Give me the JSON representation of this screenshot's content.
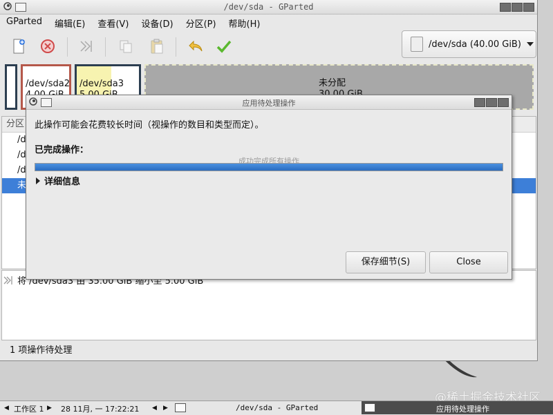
{
  "window": {
    "title": "/dev/sda - GParted"
  },
  "menu": [
    "GParted",
    "编辑(E)",
    "查看(V)",
    "设备(D)",
    "分区(P)",
    "帮助(H)"
  ],
  "toolbar": {
    "icons": [
      "new-icon",
      "delete-icon",
      "resize-move-icon",
      "copy-icon",
      "paste-icon",
      "undo-icon",
      "apply-icon"
    ]
  },
  "device_selector": {
    "label": "/dev/sda (40.00 GiB)"
  },
  "disk_graphic": {
    "partitions": [
      {
        "name": "",
        "size": "",
        "color": "#2c3e50"
      },
      {
        "name": "/dev/sda2",
        "size": "4.00 GiB",
        "color": "#b5584a"
      },
      {
        "name": "/dev/sda3",
        "size": "5.00 GiB",
        "color": "#2c3e50",
        "used_fraction": 0.55
      },
      {
        "name": "未分配",
        "size": "30.00 GiB",
        "color": "#a8a8a8"
      }
    ]
  },
  "partition_list": {
    "header": "分区",
    "rows": [
      "/d",
      "/d",
      "/d",
      "未"
    ],
    "selected_index": 3
  },
  "pending": {
    "operation": "将 /dev/sda3 由 35.00 GiB 缩小至 5.00 GiB",
    "status": "1 项操作待处理"
  },
  "dialog": {
    "title": "应用待处理操作",
    "message": "此操作可能会花费较长时间（视操作的数目和类型而定）。",
    "completed_label": "已完成操作：",
    "progress_text": "成功完成所有操作",
    "progress_fraction": 1.0,
    "details_label": "详细信息",
    "save_button": "保存细节(S)",
    "close_button": "Close"
  },
  "taskbar": {
    "workspace": "工作区 1",
    "datetime": "28 11月, 一 17:22:21",
    "task1": "/dev/sda - GParted",
    "task2": "应用待处理操作"
  },
  "watermark": "@稀土掘金技术社区",
  "colors": {
    "accent": "#3d7fd8",
    "progress": "#2a6cc0",
    "unallocated": "#a8a8a8",
    "sda2_border": "#b5584a"
  }
}
